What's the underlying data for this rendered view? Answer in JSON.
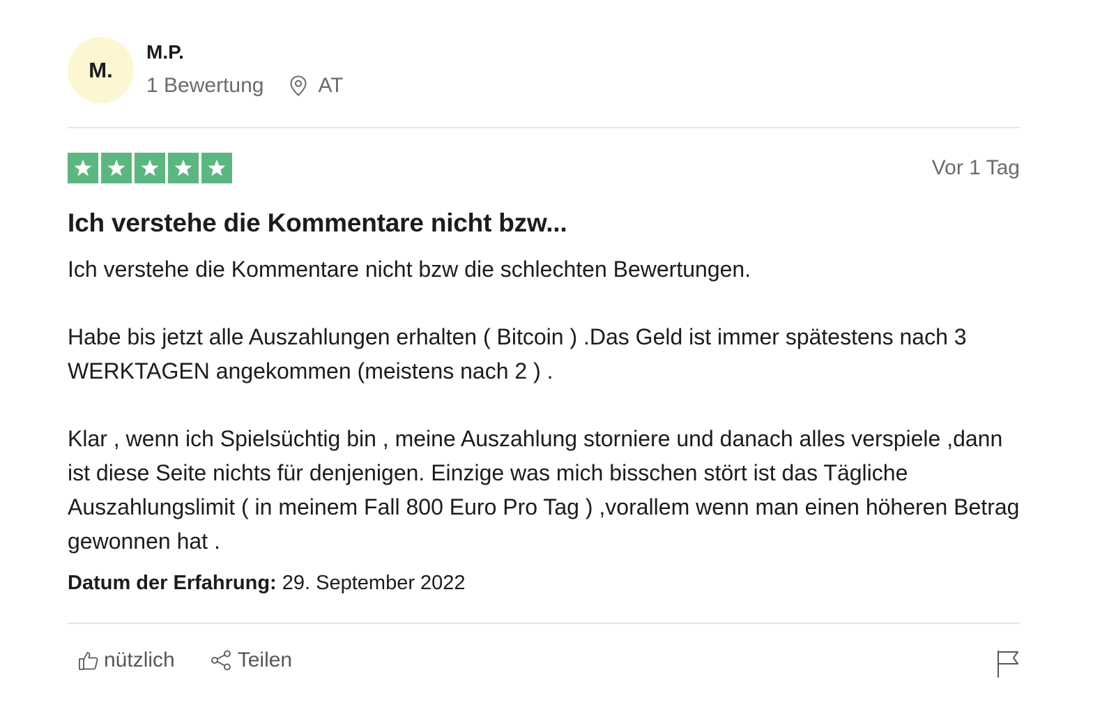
{
  "reviewer": {
    "initials": "M.",
    "name": "M.P.",
    "review_count": "1 Bewertung",
    "location_icon": "location-pin-icon",
    "country": "AT"
  },
  "rating": {
    "stars": 5,
    "max_stars": 5,
    "color": "#5bb77f"
  },
  "review": {
    "date": "Vor 1 Tag",
    "title": "Ich verstehe die Kommentare nicht bzw...",
    "paragraphs": [
      "Ich verstehe die Kommentare nicht bzw die schlechten Bewertungen.",
      "Habe bis jetzt alle Auszahlungen erhalten ( Bitcoin ) .Das Geld ist immer spätestens nach 3 WERKTAGEN angekommen (meistens nach 2 ) .",
      "Klar , wenn ich Spielsüchtig bin , meine Auszahlung storniere und danach alles verspiele ,dann ist diese Seite nichts für denjenigen. Einzige was mich bisschen stört ist das Tägliche Auszahlungslimit ( in meinem Fall 800 Euro Pro Tag ) ,vorallem wenn man einen höheren Betrag gewonnen hat ."
    ],
    "experience_label": "Datum der Erfahrung:",
    "experience_date": "29. September 2022"
  },
  "actions": {
    "useful_label": "nützlich",
    "useful_icon": "thumbs-up-icon",
    "share_label": "Teilen",
    "share_icon": "share-icon",
    "report_icon": "flag-icon"
  },
  "colors": {
    "avatar_bg": "#fcf6d2",
    "muted_text": "#6b6b6b",
    "divider": "#e5e5e5"
  }
}
